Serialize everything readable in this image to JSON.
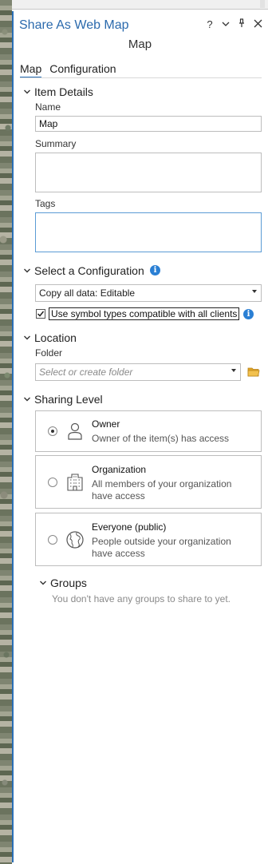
{
  "panel": {
    "title": "Share As Web Map",
    "subtitle": "Map",
    "controls": {
      "help": "?",
      "menu": "⌄",
      "pin": "⊥",
      "close": "✕"
    }
  },
  "tabs": [
    {
      "label": "Map",
      "active": true
    },
    {
      "label": "Configuration",
      "active": false
    }
  ],
  "item_details": {
    "heading": "Item Details",
    "name_label": "Name",
    "name_value": "Map",
    "summary_label": "Summary",
    "tags_label": "Tags"
  },
  "configuration": {
    "heading": "Select a Configuration",
    "selected": "Copy all data: Editable",
    "checkbox_label": "Use symbol types compatible with all clients",
    "checkbox_checked": true
  },
  "location": {
    "heading": "Location",
    "folder_label": "Folder",
    "folder_placeholder": "Select or create folder"
  },
  "sharing": {
    "heading": "Sharing Level",
    "options": [
      {
        "title": "Owner",
        "desc": "Owner of the item(s) has access",
        "checked": true,
        "icon": "person-icon"
      },
      {
        "title": "Organization",
        "desc": "All members of your organization have access",
        "checked": false,
        "icon": "building-icon"
      },
      {
        "title": "Everyone (public)",
        "desc": "People outside your organization have access",
        "checked": false,
        "icon": "globe-icon"
      }
    ]
  },
  "groups": {
    "heading": "Groups",
    "note": "You don't have any groups to share to yet."
  },
  "colors": {
    "accent": "#2a6fb6",
    "info": "#2a7fd4",
    "folder": "#e0a526"
  }
}
